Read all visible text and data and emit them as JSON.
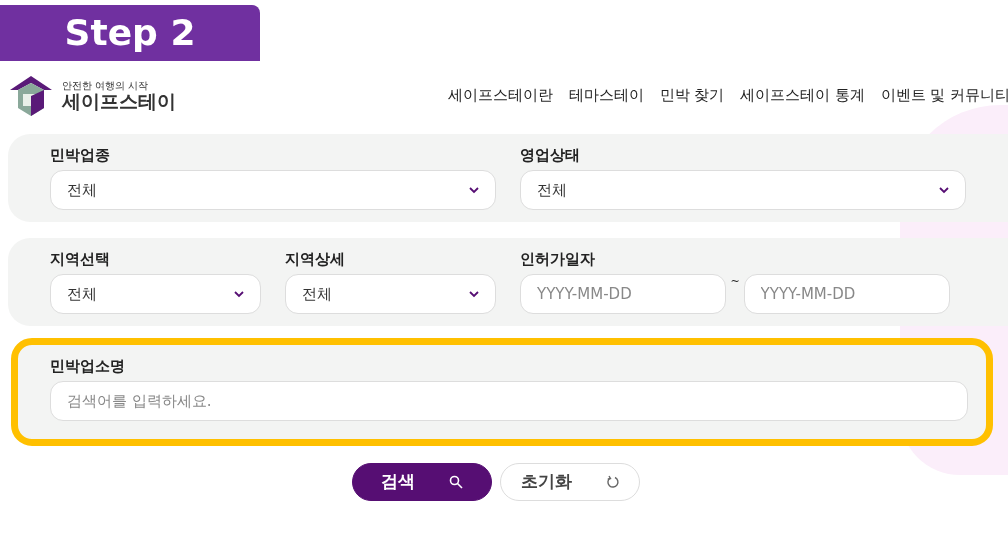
{
  "step_badge": "Step 2",
  "logo": {
    "tagline": "안전한 여행의 시작",
    "name": "세이프스테이"
  },
  "nav": [
    "세이프스테이란",
    "테마스테이",
    "민박 찾기",
    "세이프스테이 통계",
    "이벤트 및 커뮤니티"
  ],
  "panels": [
    {
      "highlighted": false,
      "groups": [
        {
          "label": "민박업종",
          "kind": "select",
          "value": "전체"
        },
        {
          "label": "영업상태",
          "kind": "select",
          "value": "전체"
        }
      ]
    },
    {
      "highlighted": false,
      "groups": [
        {
          "label": "지역선택",
          "kind": "select",
          "value": "전체"
        },
        {
          "label": "지역상세",
          "kind": "select",
          "value": "전체"
        },
        {
          "label": "인허가일자",
          "kind": "daterange",
          "from_placeholder": "YYYY-MM-DD",
          "separator": "~",
          "to_placeholder": "YYYY-MM-DD"
        }
      ]
    },
    {
      "highlighted": true,
      "groups": [
        {
          "label": "민박업소명",
          "kind": "text",
          "placeholder": "검색어를 입력하세요."
        }
      ]
    }
  ],
  "buttons": [
    {
      "label": "검색",
      "kind": "search"
    },
    {
      "label": "초기화",
      "kind": "reset"
    }
  ]
}
